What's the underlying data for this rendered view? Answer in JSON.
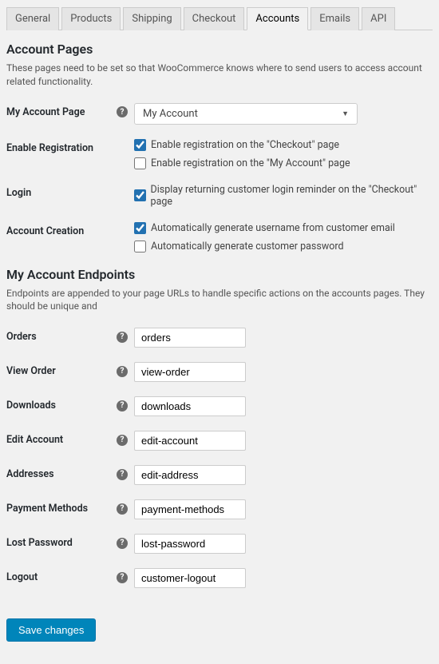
{
  "tabs": {
    "general": "General",
    "products": "Products",
    "shipping": "Shipping",
    "checkout": "Checkout",
    "accounts": "Accounts",
    "emails": "Emails",
    "api": "API"
  },
  "section1": {
    "title": "Account Pages",
    "desc": "These pages need to be set so that WooCommerce knows where to send users to access account related functionality."
  },
  "myAccountPage": {
    "label": "My Account Page",
    "value": "My Account"
  },
  "enableRegistration": {
    "label": "Enable Registration",
    "opt1": "Enable registration on the \"Checkout\" page",
    "opt2": "Enable registration on the \"My Account\" page"
  },
  "login": {
    "label": "Login",
    "opt1": "Display returning customer login reminder on the \"Checkout\" page"
  },
  "accountCreation": {
    "label": "Account Creation",
    "opt1": "Automatically generate username from customer email",
    "opt2": "Automatically generate customer password"
  },
  "section2": {
    "title": "My Account Endpoints",
    "desc": "Endpoints are appended to your page URLs to handle specific actions on the accounts pages. They should be unique and"
  },
  "endpoints": {
    "orders": {
      "label": "Orders",
      "value": "orders"
    },
    "viewOrder": {
      "label": "View Order",
      "value": "view-order"
    },
    "downloads": {
      "label": "Downloads",
      "value": "downloads"
    },
    "editAccount": {
      "label": "Edit Account",
      "value": "edit-account"
    },
    "addresses": {
      "label": "Addresses",
      "value": "edit-address"
    },
    "paymentMethods": {
      "label": "Payment Methods",
      "value": "payment-methods"
    },
    "lostPassword": {
      "label": "Lost Password",
      "value": "lost-password"
    },
    "logout": {
      "label": "Logout",
      "value": "customer-logout"
    }
  },
  "saveButton": "Save changes",
  "helpTip": "?"
}
